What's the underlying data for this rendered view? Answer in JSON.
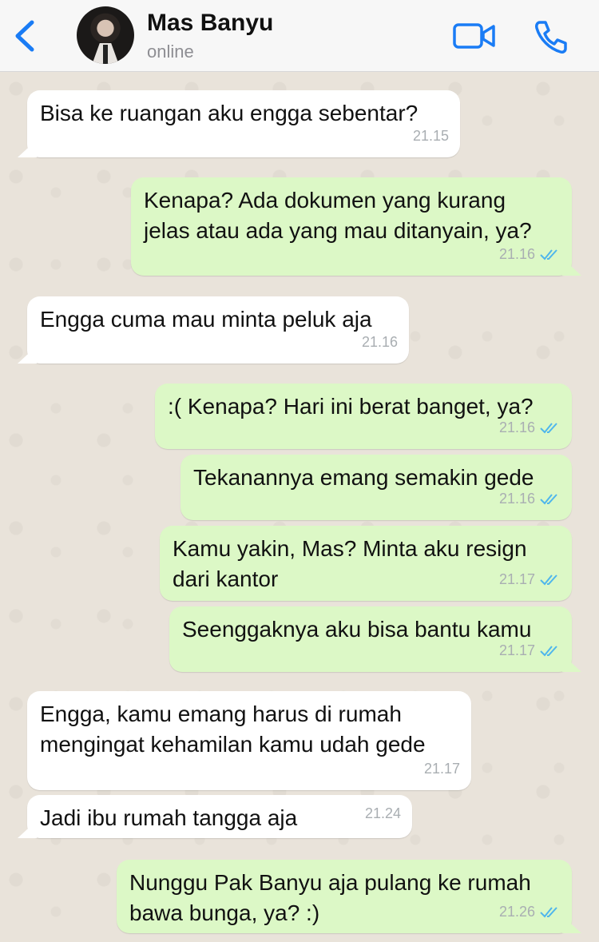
{
  "header": {
    "contact_name": "Mas Banyu",
    "status": "online"
  },
  "colors": {
    "accent": "#1a7cf5",
    "outgoing_bubble": "#dcf8c6",
    "incoming_bubble": "#ffffff",
    "chat_background": "#e9e3da",
    "read_tick": "#4fb6ec"
  },
  "icons": {
    "back": "chevron-left-icon",
    "video": "video-camera-icon",
    "call": "phone-icon",
    "read": "double-check-icon"
  },
  "messages": [
    {
      "direction": "incoming",
      "text": "Bisa ke ruangan aku engga sebentar?",
      "time": "21.15"
    },
    {
      "direction": "outgoing",
      "text": "Kenapa? Ada dokumen yang kurang\njelas atau ada yang mau ditanyain, ya?",
      "time": "21.16",
      "read": true
    },
    {
      "direction": "incoming",
      "text": "Engga cuma mau minta peluk aja",
      "time": "21.16"
    },
    {
      "direction": "outgoing",
      "text": ":( Kenapa? Hari ini berat banget, ya?",
      "time": "21.16",
      "read": true
    },
    {
      "direction": "outgoing",
      "text": "Tekanannya emang semakin gede",
      "time": "21.16",
      "read": true
    },
    {
      "direction": "outgoing",
      "text": "Kamu yakin, Mas? Minta aku resign\ndari kantor",
      "time": "21.17",
      "read": true
    },
    {
      "direction": "outgoing",
      "text": "Seenggaknya aku bisa bantu kamu",
      "time": "21.17",
      "read": true
    },
    {
      "direction": "incoming",
      "text": "Engga, kamu emang harus di rumah\nmengingat kehamilan kamu udah gede",
      "time": "21.17"
    },
    {
      "direction": "incoming",
      "text": "Jadi ibu rumah tangga aja",
      "time": "21.24"
    },
    {
      "direction": "outgoing",
      "text": "Nunggu Pak Banyu aja pulang ke rumah\nbawa bunga, ya? :)",
      "time": "21.26",
      "read": true
    }
  ]
}
